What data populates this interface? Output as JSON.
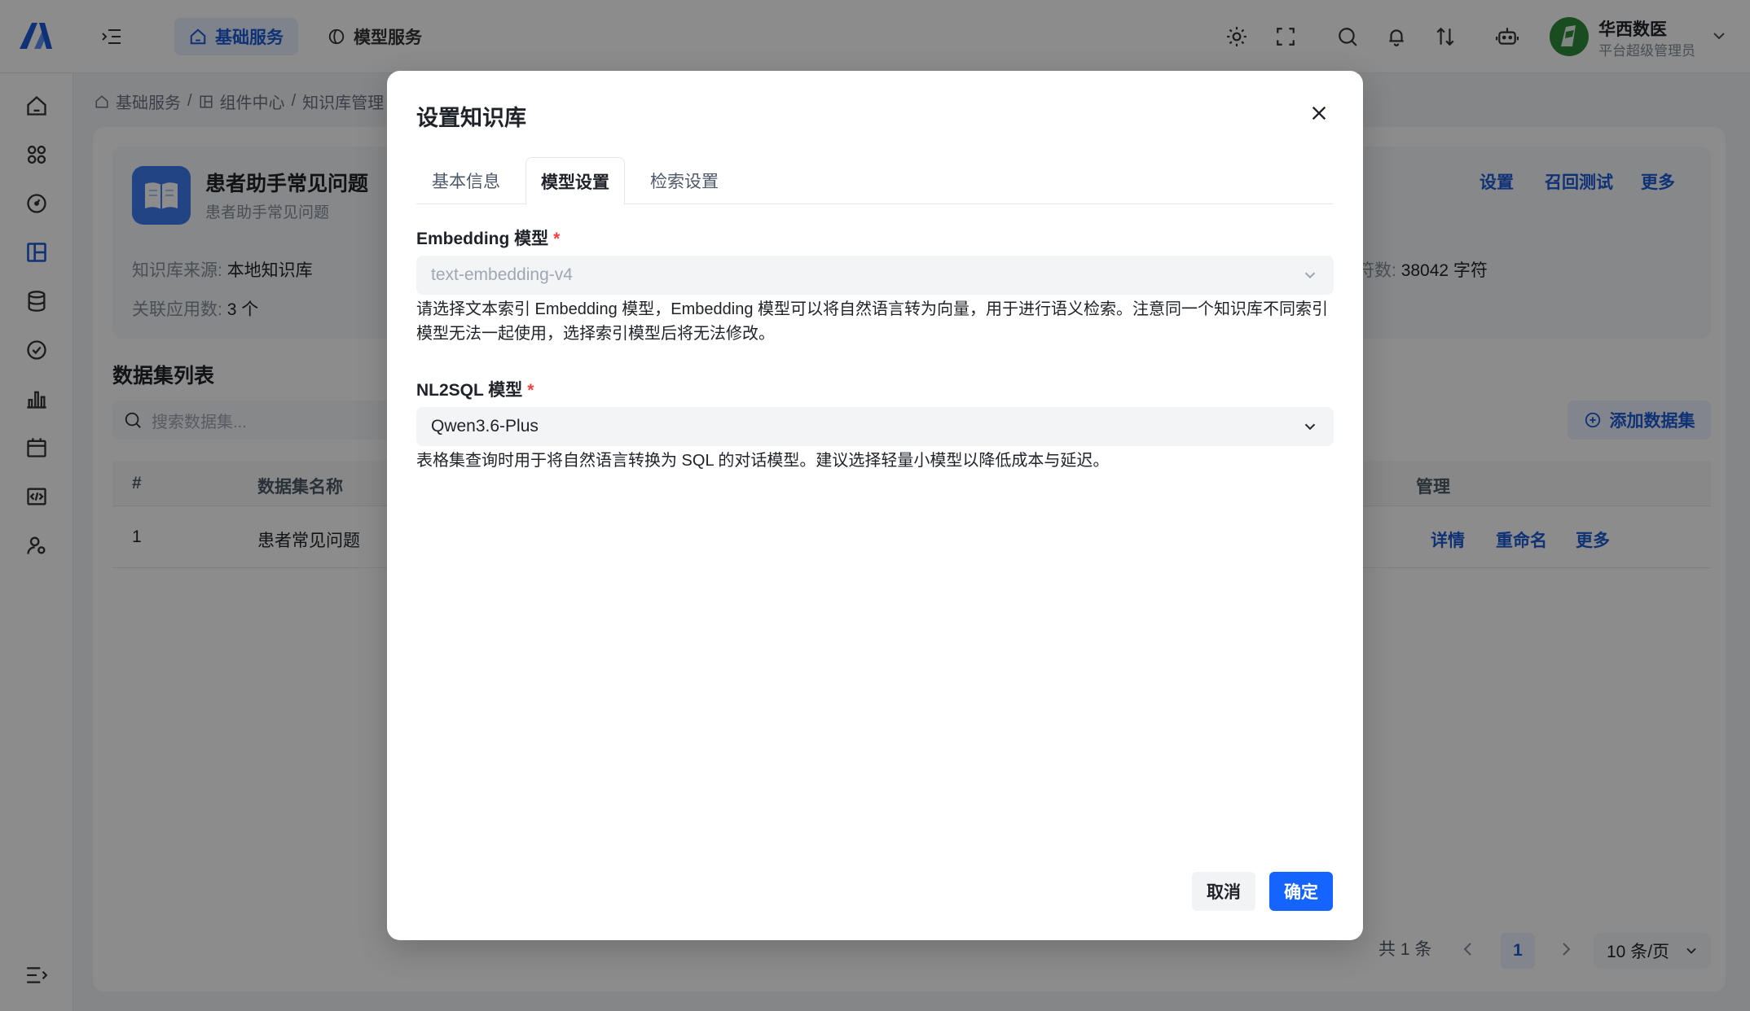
{
  "topbar": {
    "nav_active": "基础服务",
    "nav_inactive": "模型服务",
    "user_name": "华西数医",
    "user_role": "平台超级管理员"
  },
  "breadcrumb": {
    "items": [
      "基础服务",
      "组件中心",
      "知识库管理"
    ],
    "separator": "/"
  },
  "kb": {
    "title": "患者助手常见问题",
    "subtitle": "患者助手常见问题",
    "source_label": "知识库来源:",
    "source_value": "本地知识库",
    "apps_label": "关联应用数:",
    "apps_value": "3 个",
    "chars_label": "符数:",
    "chars_value": "38042 字符",
    "actions": [
      "设置",
      "召回测试",
      "更多"
    ]
  },
  "datasets": {
    "title": "数据集列表",
    "search_placeholder": "搜索数据集...",
    "add_label": "添加数据集",
    "columns": [
      "#",
      "数据集名称",
      "管理"
    ],
    "rows": [
      {
        "index": "1",
        "name": "患者常见问题",
        "actions": [
          "详情",
          "重命名",
          "更多"
        ]
      }
    ]
  },
  "pagination": {
    "total": "共 1 条",
    "current_page": "1",
    "page_size": "10 条/页"
  },
  "modal": {
    "title": "设置知识库",
    "tabs": [
      "基本信息",
      "模型设置",
      "检索设置"
    ],
    "active_tab": "模型设置",
    "embedding": {
      "label": "Embedding 模型",
      "required_mark": "*",
      "value": "text-embedding-v4",
      "help": "请选择文本索引 Embedding 模型，Embedding 模型可以将自然语言转为向量，用于进行语义检索。注意同一个知识库不同索引模型无法一起使用，选择索引模型后将无法修改。"
    },
    "nl2sql": {
      "label": "NL2SQL 模型",
      "required_mark": "*",
      "value": "Qwen3.6-Plus",
      "help": "表格集查询时用于将自然语言转换为 SQL 的对话模型。建议选择轻量小模型以降低成本与延迟。"
    },
    "cancel_label": "取消",
    "ok_label": "确定"
  },
  "colors": {
    "accent": "#1664ff",
    "link": "#1d5bd8",
    "required": "#f53f3f",
    "kb_icon": "#3b7cf0",
    "avatar": "#2e8b3a"
  },
  "icons": {
    "logo": "app-logo",
    "collapse": "menu-collapse-icon",
    "nav_active": "home-icon",
    "nav_inactive": "model-icon",
    "toolbar": [
      "sun-icon",
      "fullscreen-icon",
      "search-icon",
      "bell-icon",
      "swap-icon",
      "robot-icon"
    ],
    "sidebar": [
      "home-icon",
      "apps-icon",
      "dashboard-icon",
      "knowledge-icon",
      "database-icon",
      "check-icon",
      "chart-icon",
      "calendar-icon",
      "code-icon",
      "user-icon"
    ]
  }
}
